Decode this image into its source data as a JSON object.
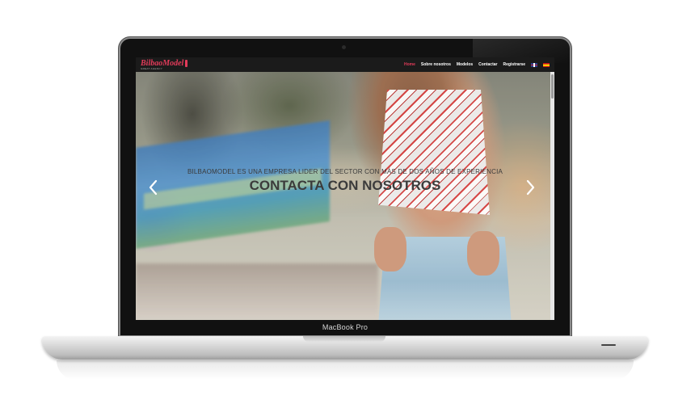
{
  "device": {
    "model_label": "MacBook Pro"
  },
  "site": {
    "logo_text": "BilbaoModel",
    "logo_subtext": "GREAT AGENCY"
  },
  "nav": {
    "items": [
      {
        "label": "Home",
        "active": true
      },
      {
        "label": "Sobre nosotros",
        "active": false
      },
      {
        "label": "Modelos",
        "active": false
      },
      {
        "label": "Contactar",
        "active": false
      },
      {
        "label": "Registrarse",
        "active": false
      }
    ],
    "languages": [
      "english-flag-icon",
      "spanish-flag-icon"
    ]
  },
  "hero": {
    "tagline": "BILBAOMODEL ES UNA EMPRESA LIDER DEL SECTOR CON MÁS DE DOS AÑOS DE EXPERIENCIA",
    "cta": "CONTACTA CON NOSOTROS",
    "prev_icon": "chevron-left-icon",
    "next_icon": "chevron-right-icon"
  },
  "colors": {
    "brand": "#e23b5a",
    "navbar": "#1b1b1b",
    "cta_text": "#3b3b3b"
  }
}
